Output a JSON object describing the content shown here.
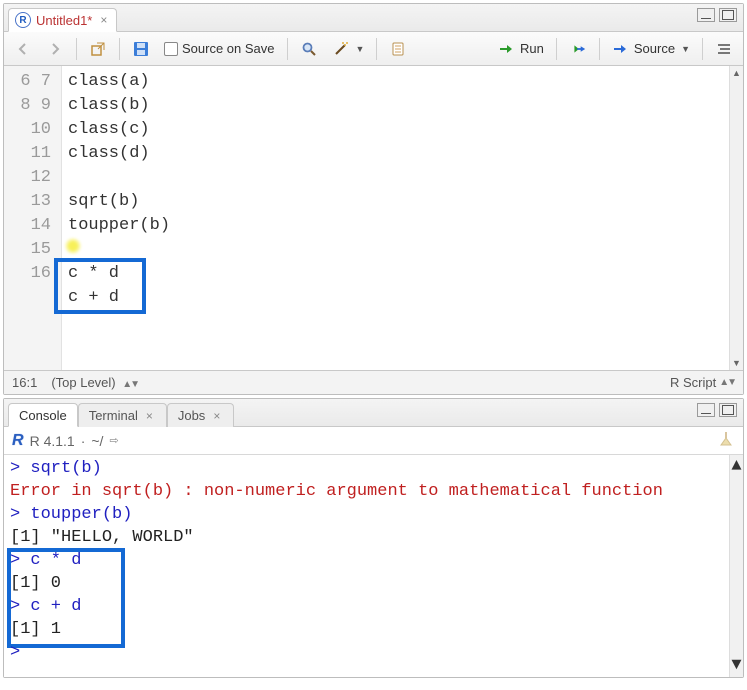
{
  "editor": {
    "tab_title": "Untitled1*",
    "source_on_save_label": "Source on Save",
    "run_label": "Run",
    "source_label": "Source",
    "gutter_start": 6,
    "gutter_end": 16,
    "code_lines": [
      "class(a)",
      "class(b)",
      "class(c)",
      "class(d)",
      "",
      "sqrt(b)",
      "toupper(b)",
      "",
      "c * d",
      "c + d",
      ""
    ],
    "status_pos": "16:1",
    "status_scope": "(Top Level)",
    "status_lang": "R Script"
  },
  "console": {
    "tabs": {
      "console": "Console",
      "terminal": "Terminal",
      "jobs": "Jobs"
    },
    "version": "R 4.1.1",
    "path_sep": "·",
    "path": "~/",
    "lines": [
      {
        "type": "cmd",
        "text": "> sqrt(b)"
      },
      {
        "type": "err",
        "text": "Error in sqrt(b) : non-numeric argument to mathematical function"
      },
      {
        "type": "cmd",
        "text": "> toupper(b)"
      },
      {
        "type": "out",
        "text": "[1] \"HELLO, WORLD\""
      },
      {
        "type": "cmd",
        "text": "> c * d"
      },
      {
        "type": "out",
        "text": "[1] 0"
      },
      {
        "type": "cmd",
        "text": "> c + d"
      },
      {
        "type": "out",
        "text": "[1] 1"
      },
      {
        "type": "cmd",
        "text": "> "
      }
    ]
  }
}
